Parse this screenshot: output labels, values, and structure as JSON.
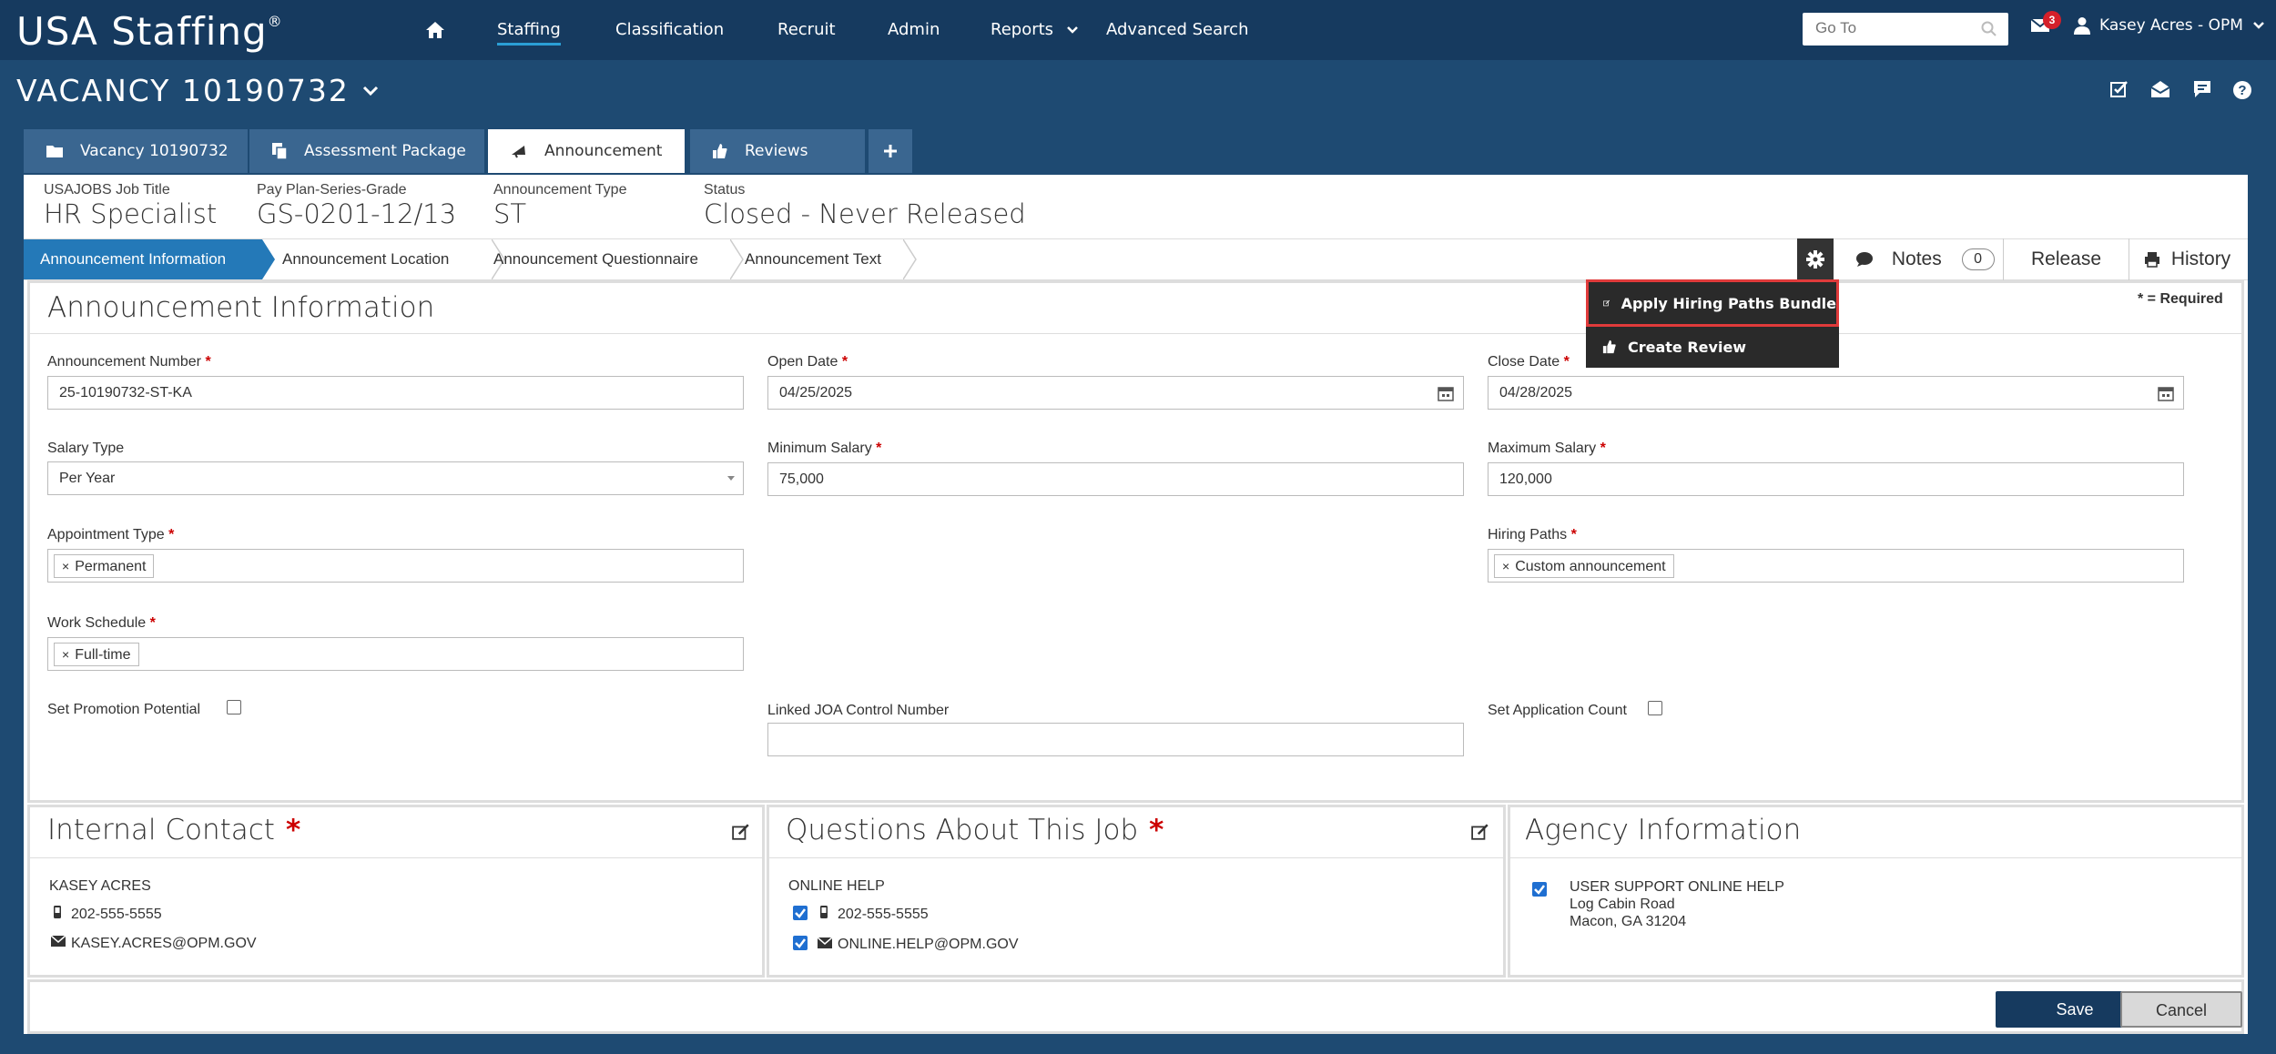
{
  "app": {
    "name": "USA Staffing",
    "mark": "®"
  },
  "nav": {
    "items": [
      "Staffing",
      "Classification",
      "Recruit",
      "Admin",
      "Reports",
      "Advanced Search"
    ],
    "active": "Staffing"
  },
  "search": {
    "placeholder": "Go To"
  },
  "user": {
    "mail_count": "3",
    "name": "Kasey Acres - OPM"
  },
  "vacancy": {
    "title": "VACANCY 10190732"
  },
  "tabs": [
    {
      "label": "Vacancy 10190732",
      "icon": "folder-icon"
    },
    {
      "label": "Assessment Package",
      "icon": "copy-icon"
    },
    {
      "label": "Announcement",
      "icon": "megaphone-icon"
    },
    {
      "label": "Reviews",
      "icon": "thumbs-up-icon"
    },
    {
      "label": "+",
      "icon": "plus-icon"
    }
  ],
  "summary": {
    "job_title_label": "USAJOBS Job Title",
    "job_title": "HR Specialist",
    "ppsg_label": "Pay Plan-Series-Grade",
    "ppsg": "GS-0201-12/13",
    "type_label": "Announcement Type",
    "type": "ST",
    "status_label": "Status",
    "status": "Closed - Never Released"
  },
  "subtabs": [
    "Announcement Information",
    "Announcement Location",
    "Announcement Questionnaire",
    "Announcement Text"
  ],
  "actions": {
    "notes_label": "Notes",
    "notes_count": "0",
    "release_label": "Release",
    "history_label": "History"
  },
  "dropdown": {
    "items": [
      "Apply Hiring Paths Bundle",
      "Create Review"
    ]
  },
  "form": {
    "title": "Announcement Information",
    "required_note": "* = Required",
    "required_mark": "*",
    "announcement_number": {
      "label": "Announcement Number",
      "value": "25-10190732-ST-KA"
    },
    "open_date": {
      "label": "Open Date",
      "value": "04/25/2025"
    },
    "close_date": {
      "label": "Close Date",
      "value": "04/28/2025"
    },
    "salary_type": {
      "label": "Salary Type",
      "value": "Per Year"
    },
    "min_salary": {
      "label": "Minimum Salary",
      "value": "75,000"
    },
    "max_salary": {
      "label": "Maximum Salary",
      "value": "120,000"
    },
    "appointment_type": {
      "label": "Appointment Type",
      "value": "Permanent"
    },
    "hiring_paths": {
      "label": "Hiring Paths",
      "value": "Custom announcement"
    },
    "work_schedule": {
      "label": "Work Schedule",
      "value": "Full-time"
    },
    "promotion_potential": {
      "label": "Set Promotion Potential"
    },
    "linked_joa": {
      "label": "Linked JOA Control Number",
      "value": ""
    },
    "application_count": {
      "label": "Set Application Count"
    },
    "chip_x": "×"
  },
  "internal_contact": {
    "title": "Internal Contact",
    "name": "KASEY ACRES",
    "phone": "202-555-5555",
    "email": "KASEY.ACRES@OPM.GOV"
  },
  "questions": {
    "title": "Questions About This Job",
    "name": "ONLINE HELP",
    "phone": "202-555-5555",
    "email": "ONLINE.HELP@OPM.GOV"
  },
  "agency": {
    "title": "Agency Information",
    "line1": "USER SUPPORT ONLINE HELP",
    "line2": "Log Cabin Road",
    "line3": "Macon, GA 31204"
  },
  "footer": {
    "save_label": "Save",
    "cancel_label": "Cancel"
  },
  "colors": {
    "nav_bg": "#163a5f",
    "page_bg": "#1e4a72",
    "tab_bg": "#3a6690",
    "active_subtab": "#2479b8",
    "required": "#cc0000",
    "highlight": "#e03b3b"
  }
}
